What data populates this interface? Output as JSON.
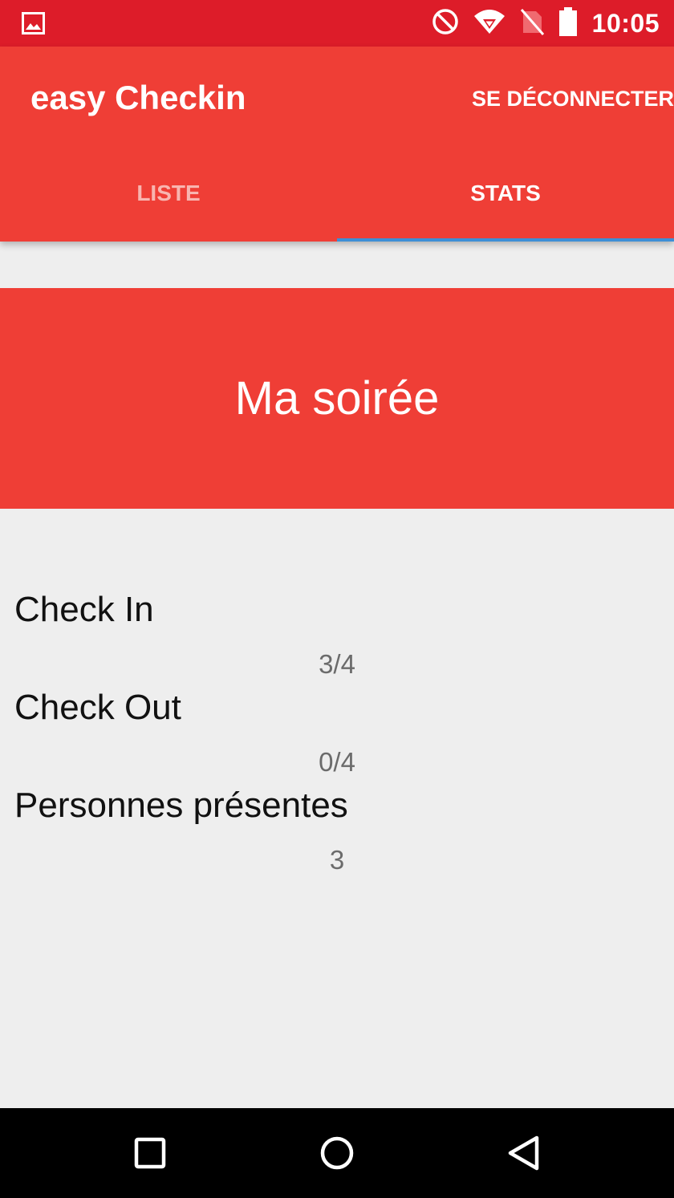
{
  "status_bar": {
    "time": "10:05",
    "icons": [
      "image-icon",
      "do-not-disturb-icon",
      "wifi-icon",
      "no-sim-icon",
      "battery-icon"
    ]
  },
  "app_bar": {
    "title": "easy Checkin",
    "logout_label": "SE DÉCONNECTER"
  },
  "tabs": [
    {
      "label": "LISTE",
      "active": false
    },
    {
      "label": "STATS",
      "active": true
    }
  ],
  "event": {
    "name": "Ma soirée"
  },
  "stats": [
    {
      "label": "Check In",
      "value": "3/4"
    },
    {
      "label": "Check Out",
      "value": "0/4"
    },
    {
      "label": "Personnes présentes",
      "value": "3"
    }
  ],
  "nav_bar": {
    "icons": [
      "recents-icon",
      "home-icon",
      "back-icon"
    ]
  },
  "colors": {
    "status_bar": "#dd1c29",
    "primary": "#ef3e36",
    "tab_indicator": "#3d8fd6",
    "background": "#eeeeee"
  }
}
